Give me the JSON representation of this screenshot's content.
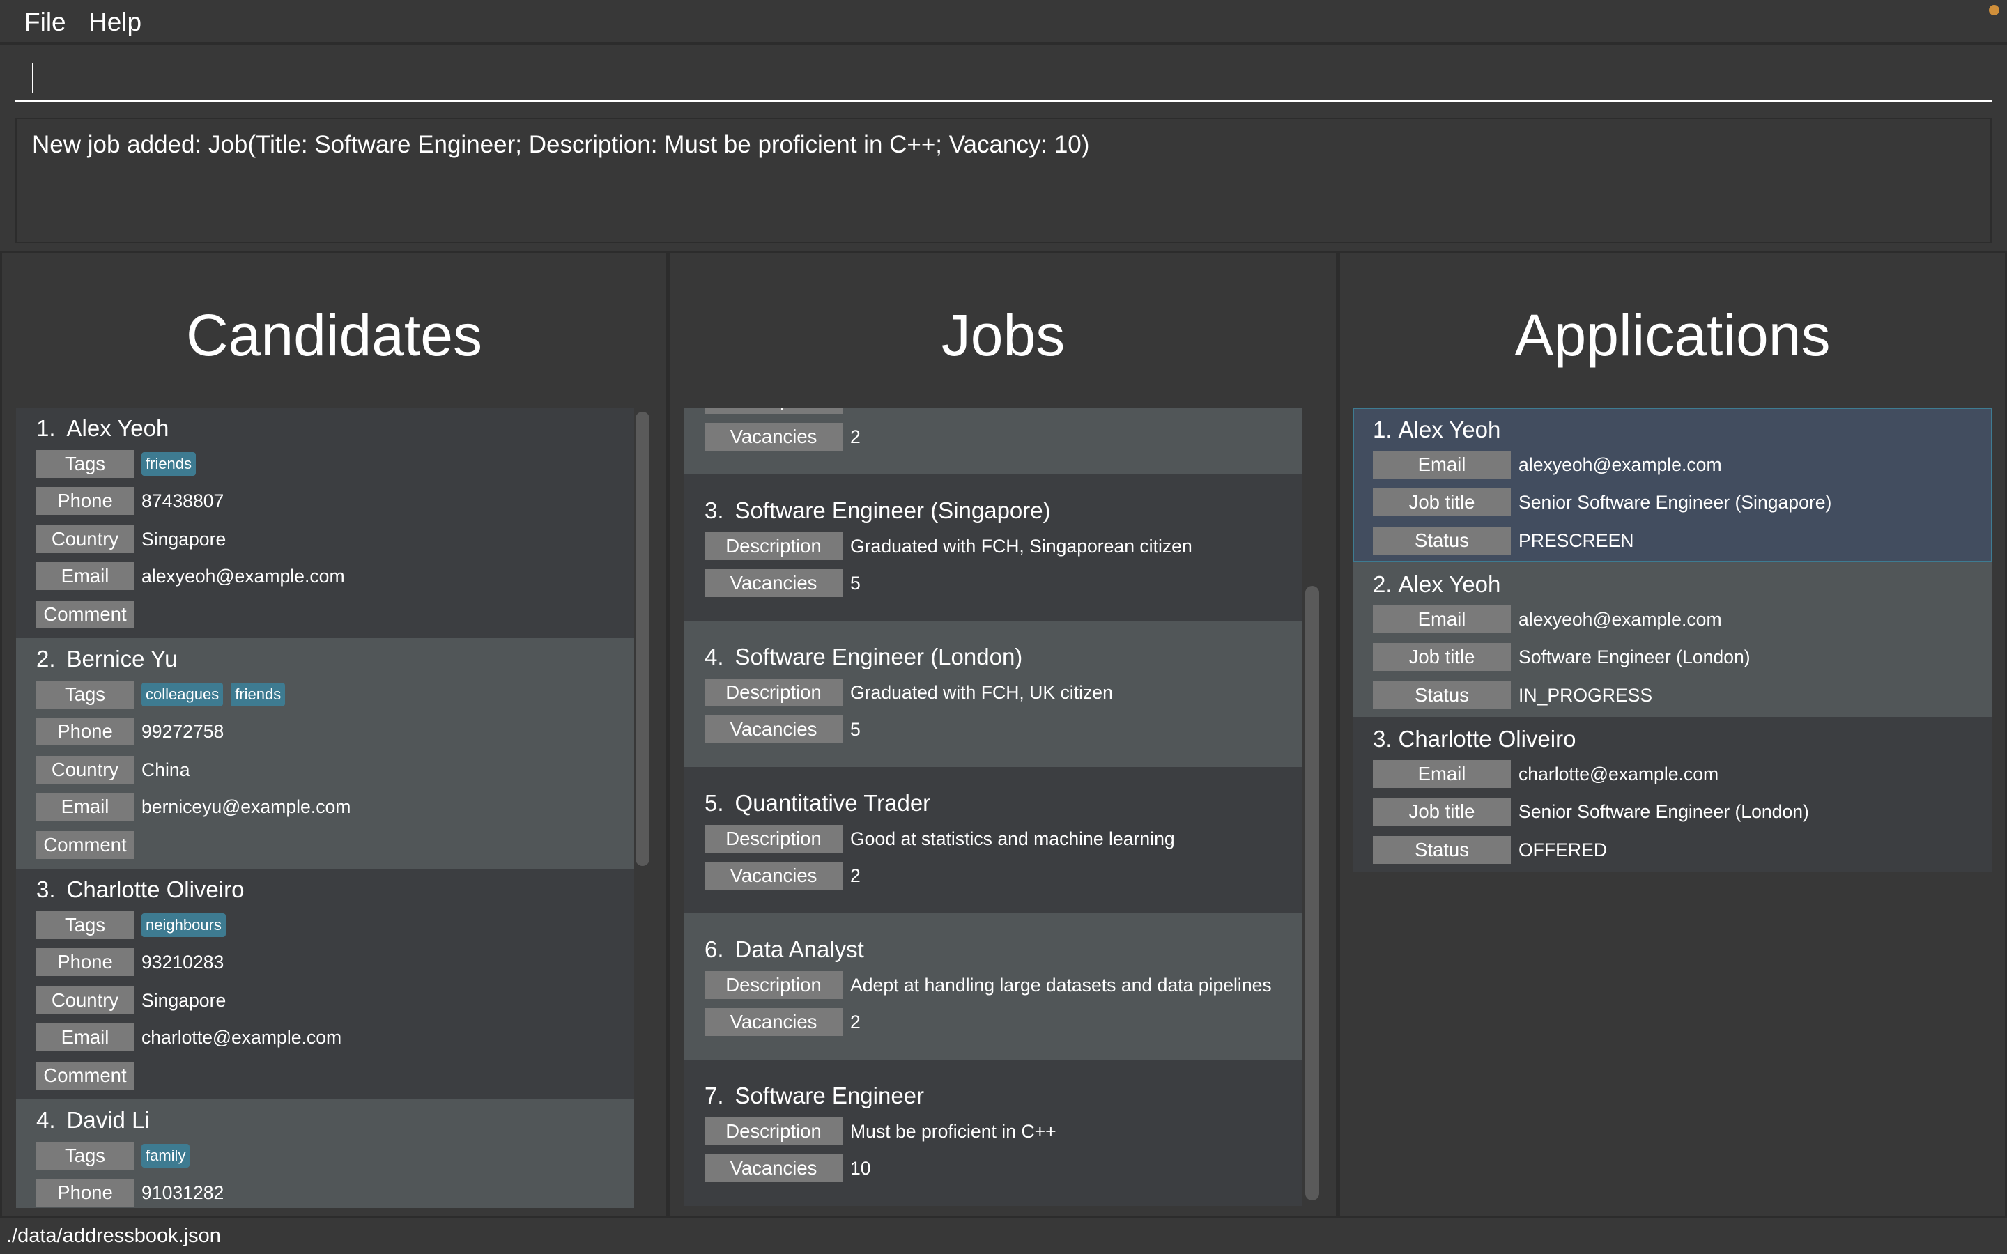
{
  "menu": {
    "file": "File",
    "help": "Help"
  },
  "command": {
    "value": ""
  },
  "result": "New job added: Job(Title: Software Engineer; Description: Must be proficient in C++; Vacancy: 10)",
  "candidates": {
    "title": "Candidates",
    "items": [
      {
        "index": "1.",
        "name": "Alex Yeoh",
        "tags": [
          "friends"
        ],
        "phone": "87438807",
        "country": "Singapore",
        "email": "alexyeoh@example.com",
        "comment": ""
      },
      {
        "index": "2.",
        "name": "Bernice Yu",
        "tags": [
          "colleagues",
          "friends"
        ],
        "phone": "99272758",
        "country": "China",
        "email": "berniceyu@example.com",
        "comment": ""
      },
      {
        "index": "3.",
        "name": "Charlotte Oliveiro",
        "tags": [
          "neighbours"
        ],
        "phone": "93210283",
        "country": "Singapore",
        "email": "charlotte@example.com",
        "comment": ""
      },
      {
        "index": "4.",
        "name": "David Li",
        "tags": [
          "family"
        ],
        "phone": "91031282"
      }
    ],
    "labels": {
      "tags": "Tags",
      "phone": "Phone",
      "country": "Country",
      "email": "Email",
      "comment": "Comment"
    }
  },
  "jobs": {
    "title": "Jobs",
    "labels": {
      "description": "Description",
      "vacancies": "Vacancies"
    },
    "items": [
      {
        "index": "",
        "title": "",
        "description": "",
        "vacancies": "2"
      },
      {
        "index": "3.",
        "title": "Software Engineer (Singapore)",
        "description": "Graduated with FCH, Singaporean citizen",
        "vacancies": "5"
      },
      {
        "index": "4.",
        "title": "Software Engineer (London)",
        "description": "Graduated with FCH, UK citizen",
        "vacancies": "5"
      },
      {
        "index": "5.",
        "title": "Quantitative Trader",
        "description": "Good at statistics and machine learning",
        "vacancies": "2"
      },
      {
        "index": "6.",
        "title": "Data Analyst",
        "description": "Adept at handling large datasets and data pipelines",
        "vacancies": "2"
      },
      {
        "index": "7.",
        "title": "Software Engineer",
        "description": "Must be proficient in C++",
        "vacancies": "10"
      }
    ]
  },
  "applications": {
    "title": "Applications",
    "labels": {
      "email": "Email",
      "job": "Job title",
      "status": "Status"
    },
    "items": [
      {
        "index": "1.",
        "name": "Alex Yeoh",
        "email": "alexyeoh@example.com",
        "job": "Senior Software Engineer (Singapore)",
        "status": "PRESCREEN",
        "selected": true
      },
      {
        "index": "2.",
        "name": "Alex Yeoh",
        "email": "alexyeoh@example.com",
        "job": "Software Engineer (London)",
        "status": "IN_PROGRESS"
      },
      {
        "index": "3.",
        "name": "Charlotte Oliveiro",
        "email": "charlotte@example.com",
        "job": "Senior Software Engineer (London)",
        "status": "OFFERED"
      }
    ]
  },
  "statusbar": "./data/addressbook.json",
  "colors": {
    "background": "#383838",
    "card": "#3c3e41",
    "card_alt": "#515658",
    "selected": "#424d5f",
    "tag": "#3e7b91",
    "label": "#7a7a7a",
    "notification_dot": "#d08f3a"
  }
}
